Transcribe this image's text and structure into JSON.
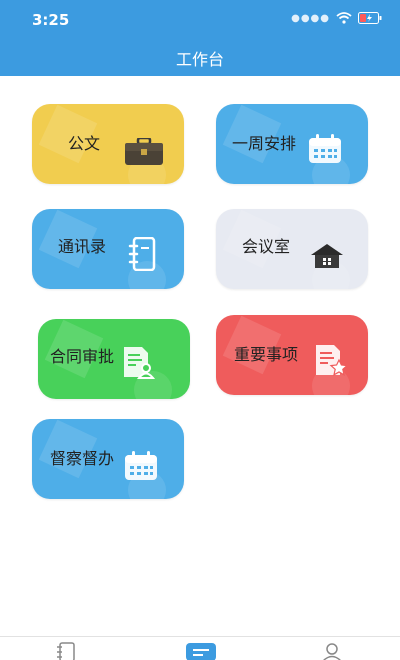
{
  "status": {
    "time": "3:25"
  },
  "header": {
    "title": "工作台"
  },
  "cards": [
    {
      "label": "公文",
      "icon": "briefcase-icon"
    },
    {
      "label": "一周安排",
      "icon": "calendar-icon"
    },
    {
      "label": "通讯录",
      "icon": "notebook-icon"
    },
    {
      "label": "会议室",
      "icon": "house-icon"
    },
    {
      "label": "合同审批",
      "icon": "document-user-icon"
    },
    {
      "label": "重要事项",
      "icon": "document-star-icon"
    },
    {
      "label": "督察督办",
      "icon": "calendar-icon"
    }
  ],
  "tabbar": {
    "items": [
      {
        "icon": "contacts-icon",
        "active": false
      },
      {
        "icon": "workbench-icon",
        "active": true
      },
      {
        "icon": "profile-icon",
        "active": false
      }
    ]
  },
  "colors": {
    "header": "#3c9be0",
    "yellow_card": "#f1cd4f",
    "blue_card": "#4eaee8",
    "gray_card": "#e7eaf2",
    "green_card": "#48d15a",
    "red_card": "#ef5c5c"
  }
}
